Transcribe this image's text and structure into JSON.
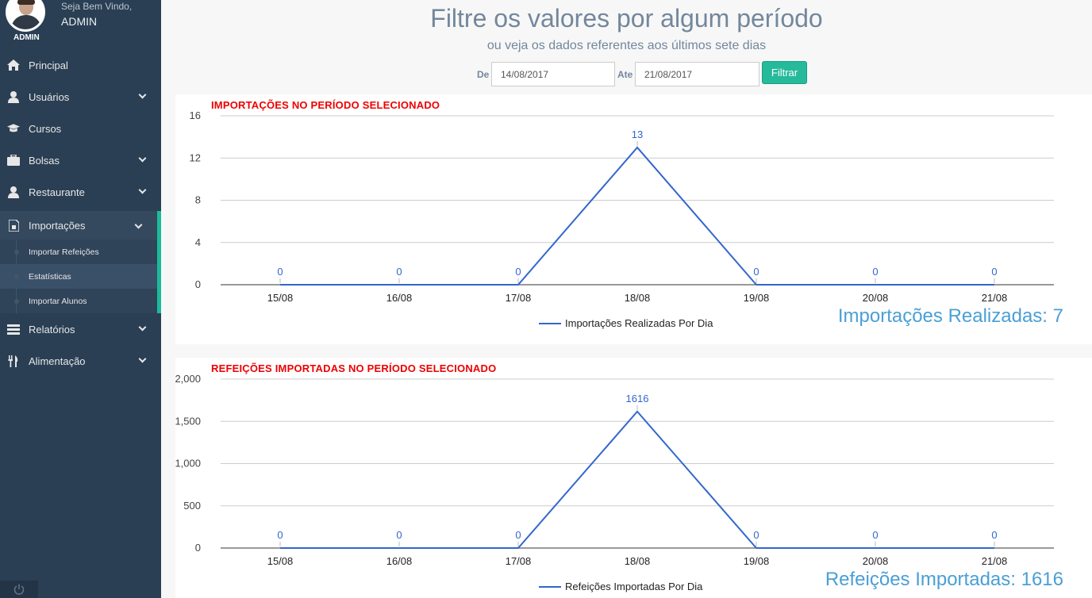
{
  "user": {
    "welcome": "Seja Bem Vindo,",
    "name": "ADMIN",
    "avatar_label": "ADMIN"
  },
  "nav": [
    {
      "label": "Principal",
      "icon": "home-icon",
      "has_chevron": false
    },
    {
      "label": "Usuários",
      "icon": "user-icon",
      "has_chevron": true
    },
    {
      "label": "Cursos",
      "icon": "graduation-cap-icon",
      "has_chevron": false
    },
    {
      "label": "Bolsas",
      "icon": "briefcase-icon",
      "has_chevron": true
    },
    {
      "label": "Restaurante",
      "icon": "user-icon",
      "has_chevron": true
    },
    {
      "label": "Importações",
      "icon": "file-icon",
      "has_chevron": true
    },
    {
      "label": "Relatórios",
      "icon": "table-icon",
      "has_chevron": true
    },
    {
      "label": "Alimentação",
      "icon": "cutlery-icon",
      "has_chevron": true
    }
  ],
  "subnav": [
    {
      "label": "Importar Refeições"
    },
    {
      "label": "Estatísticas"
    },
    {
      "label": "Importar Alunos"
    }
  ],
  "header": {
    "title": "Filtre os valores por algum período",
    "subtitle": "ou veja os dados referentes aos últimos sete dias"
  },
  "filter": {
    "from_label": "De",
    "from_value": "14/08/2017",
    "to_label": "Ate",
    "to_value": "21/08/2017",
    "button": "Filtrar"
  },
  "panels": [
    {
      "title": "IMPORTAÇÕES NO PERÍODO SELECIONADO",
      "total": "Importações Realizadas: 7"
    },
    {
      "title": "REFEIÇÕES IMPORTADAS NO PERÍODO SELECIONADO",
      "total": "Refeições Importadas: 1616"
    }
  ],
  "chart_data": [
    {
      "type": "line",
      "categories": [
        "15/08",
        "16/08",
        "17/08",
        "18/08",
        "19/08",
        "20/08",
        "21/08"
      ],
      "series": [
        {
          "name": "Importações Realizadas Por Dia",
          "values": [
            0,
            0,
            0,
            13,
            0,
            0,
            0
          ]
        }
      ],
      "ylim": [
        0,
        16
      ],
      "yticks": [
        "0",
        "4",
        "8",
        "12",
        "16"
      ],
      "ytick_values": [
        0,
        4,
        8,
        12,
        16
      ],
      "color": "#3366cc",
      "grid": true,
      "legend": "bottom"
    },
    {
      "type": "line",
      "categories": [
        "15/08",
        "16/08",
        "17/08",
        "18/08",
        "19/08",
        "20/08",
        "21/08"
      ],
      "series": [
        {
          "name": "Refeições Importadas Por Dia",
          "values": [
            0,
            0,
            0,
            1616,
            0,
            0,
            0
          ]
        }
      ],
      "ylim": [
        0,
        2000
      ],
      "yticks": [
        "0",
        "500",
        "1,000",
        "1,500",
        "2,000"
      ],
      "ytick_values": [
        0,
        500,
        1000,
        1500,
        2000
      ],
      "color": "#3366cc",
      "grid": true,
      "legend": "bottom"
    }
  ]
}
